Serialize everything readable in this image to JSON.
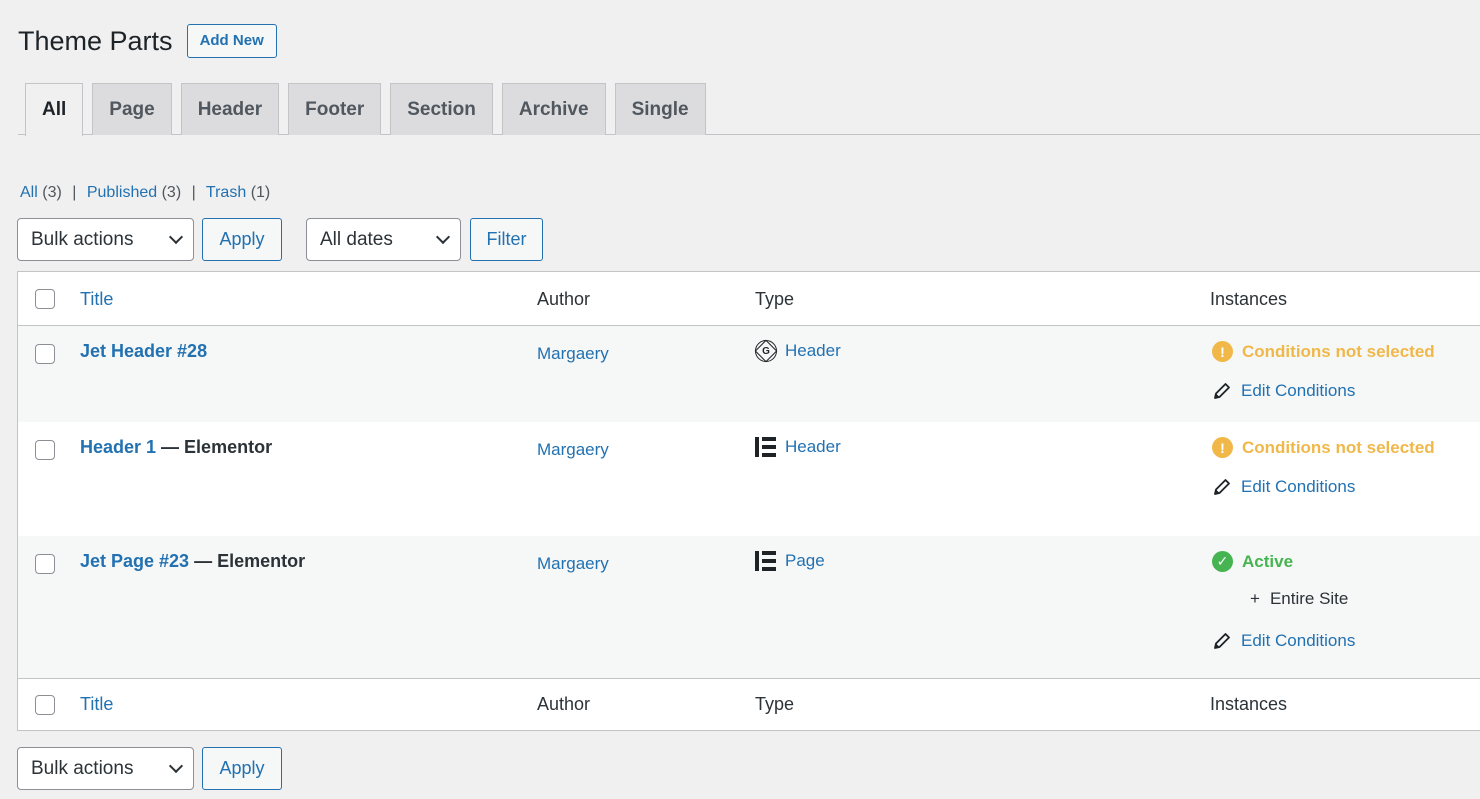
{
  "header": {
    "title": "Theme Parts",
    "add_new_label": "Add New"
  },
  "tabs": [
    {
      "label": "All",
      "active": true
    },
    {
      "label": "Page",
      "active": false
    },
    {
      "label": "Header",
      "active": false
    },
    {
      "label": "Footer",
      "active": false
    },
    {
      "label": "Section",
      "active": false
    },
    {
      "label": "Archive",
      "active": false
    },
    {
      "label": "Single",
      "active": false
    }
  ],
  "views": {
    "all_label": "All",
    "all_count": "(3)",
    "published_label": "Published",
    "published_count": "(3)",
    "trash_label": "Trash",
    "trash_count": "(1)",
    "separator": "|"
  },
  "top_nav": {
    "bulk_actions": "Bulk actions",
    "apply_label": "Apply",
    "dates": "All dates",
    "filter_label": "Filter"
  },
  "bottom_nav": {
    "bulk_actions": "Bulk actions",
    "apply_label": "Apply"
  },
  "columns": {
    "title": "Title",
    "author": "Author",
    "type": "Type",
    "instances": "Instances"
  },
  "rows": [
    {
      "title": "Jet Header #28",
      "suffix": "",
      "author": "Margaery",
      "type": "Header",
      "type_icon": "gutenberg-icon",
      "status": "Conditions not selected",
      "condition": "",
      "edit_label": "Edit Conditions"
    },
    {
      "title": "Header 1",
      "suffix": " — Elementor",
      "author": "Margaery",
      "type": "Header",
      "type_icon": "elementor-icon",
      "status": "Conditions not selected",
      "condition": "",
      "edit_label": "Edit Conditions"
    },
    {
      "title": "Jet Page #23",
      "suffix": " — Elementor",
      "author": "Margaery",
      "type": "Page",
      "type_icon": "elementor-icon",
      "status": "Active",
      "condition_prefix": "+",
      "condition": "Entire Site",
      "edit_label": "Edit Conditions"
    }
  ],
  "colors": {
    "link": "#2271b1",
    "warning": "#f0b849",
    "success": "#46b450",
    "background": "#f0f0f1"
  }
}
